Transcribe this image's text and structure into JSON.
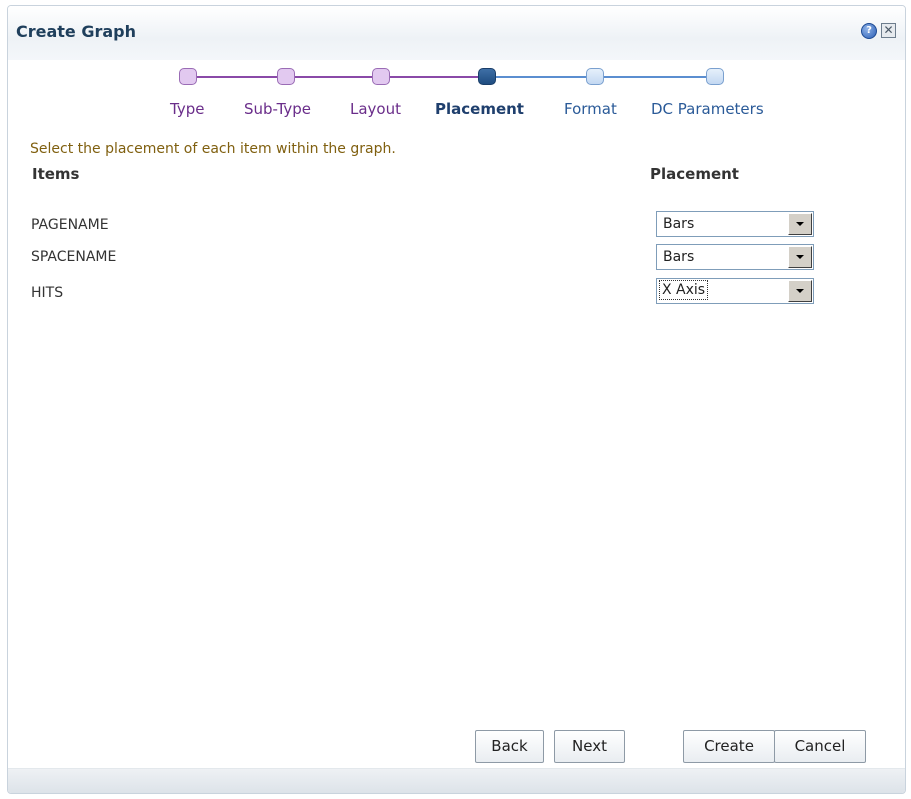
{
  "dialog": {
    "title": "Create Graph",
    "help_icon": "help-icon",
    "close_icon": "close-icon"
  },
  "train": {
    "steps": [
      {
        "label": "Type",
        "state": "visited"
      },
      {
        "label": "Sub-Type",
        "state": "visited"
      },
      {
        "label": "Layout",
        "state": "visited"
      },
      {
        "label": "Placement",
        "state": "current"
      },
      {
        "label": "Format",
        "state": "unvisited"
      },
      {
        "label": "DC Parameters",
        "state": "unvisited"
      }
    ],
    "colors": {
      "visited": "#6a2d8a",
      "current": "#1f4c80",
      "unvisited": "#5b8ed0"
    }
  },
  "main": {
    "instruction": "Select the placement of each item within the graph.",
    "items_header": "Items",
    "placement_header": "Placement",
    "rows": [
      {
        "item": "PAGENAME",
        "placement": "Bars"
      },
      {
        "item": "SPACENAME",
        "placement": "Bars"
      },
      {
        "item": "HITS",
        "placement": "X Axis"
      }
    ]
  },
  "buttons": {
    "back": "Back",
    "next": "Next",
    "create": "Create",
    "cancel": "Cancel"
  }
}
